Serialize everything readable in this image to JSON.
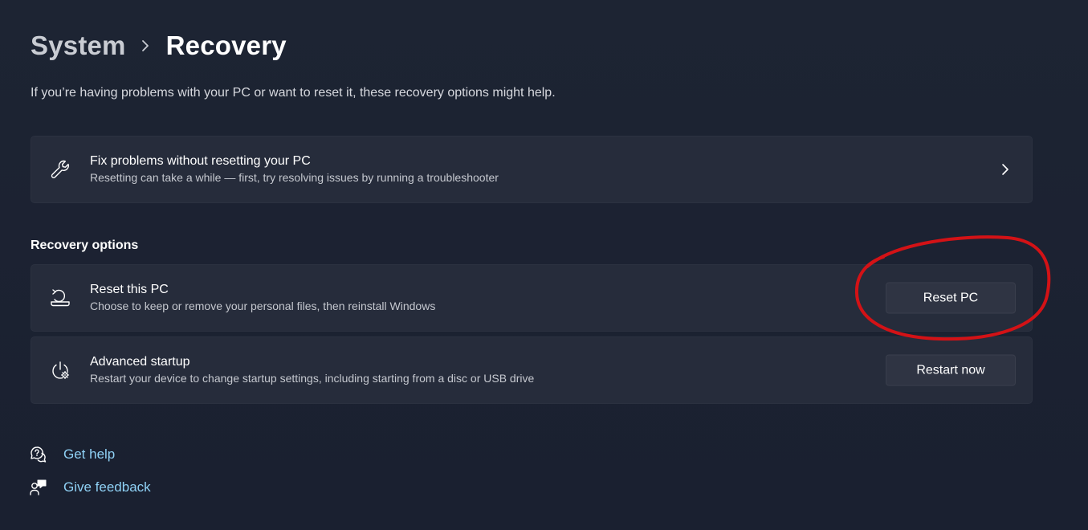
{
  "breadcrumb": {
    "parent": "System",
    "current": "Recovery"
  },
  "subtitle": "If you’re having problems with your PC or want to reset it, these recovery options might help.",
  "fix_card": {
    "title": "Fix problems without resetting your PC",
    "description": "Resetting can take a while — first, try resolving issues by running a troubleshooter",
    "icon": "wrench-icon"
  },
  "recovery_options": {
    "label": "Recovery options",
    "items": [
      {
        "title": "Reset this PC",
        "description": "Choose to keep or remove your personal files, then reinstall Windows",
        "button": "Reset PC",
        "icon": "reset-pc-icon"
      },
      {
        "title": "Advanced startup",
        "description": "Restart your device to change startup settings, including starting from a disc or USB drive",
        "button": "Restart now",
        "icon": "advanced-startup-icon"
      }
    ]
  },
  "links": {
    "get_help": "Get help",
    "give_feedback": "Give feedback"
  },
  "colors": {
    "background": "#1b2130",
    "card": "#262c3b",
    "link": "#8fd1f5",
    "annotation": "#d31216"
  }
}
